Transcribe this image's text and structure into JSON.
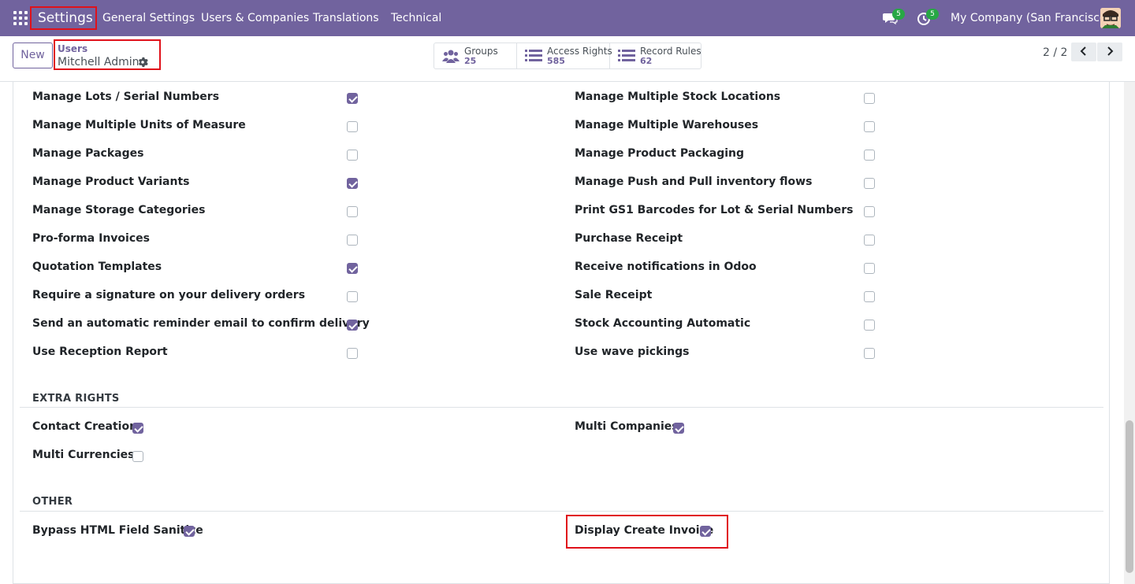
{
  "navbar": {
    "brand": "Settings",
    "menu": [
      "General Settings",
      "Users & Companies",
      "Translations",
      "Technical"
    ],
    "messages_badge": "5",
    "activities_badge": "5",
    "company": "My Company (San Francisco)"
  },
  "control": {
    "new_label": "New",
    "breadcrumb_parent": "Users",
    "breadcrumb_current": "Mitchell Admin",
    "stats": [
      {
        "label": "Groups",
        "value": "25",
        "icon": "users-icon"
      },
      {
        "label": "Access Rights",
        "value": "585",
        "icon": "list-icon"
      },
      {
        "label": "Record Rules",
        "value": "62",
        "icon": "list-icon"
      }
    ],
    "pager": "2 / 2"
  },
  "rights_left": [
    {
      "label": "Manage Lots / Serial Numbers",
      "checked": true
    },
    {
      "label": "Manage Multiple Units of Measure",
      "checked": false
    },
    {
      "label": "Manage Packages",
      "checked": false
    },
    {
      "label": "Manage Product Variants",
      "checked": true
    },
    {
      "label": "Manage Storage Categories",
      "checked": false
    },
    {
      "label": "Pro-forma Invoices",
      "checked": false
    },
    {
      "label": "Quotation Templates",
      "checked": true
    },
    {
      "label": "Require a signature on your delivery orders",
      "checked": false
    },
    {
      "label": "Send an automatic reminder email to confirm delivery",
      "checked": true
    },
    {
      "label": "Use Reception Report",
      "checked": false
    }
  ],
  "rights_right": [
    {
      "label": "Manage Multiple Stock Locations",
      "checked": false
    },
    {
      "label": "Manage Multiple Warehouses",
      "checked": false
    },
    {
      "label": "Manage Product Packaging",
      "checked": false
    },
    {
      "label": "Manage Push and Pull inventory flows",
      "checked": false
    },
    {
      "label": "Print GS1 Barcodes for Lot & Serial Numbers",
      "checked": false
    },
    {
      "label": "Purchase Receipt",
      "checked": false
    },
    {
      "label": "Receive notifications in Odoo",
      "checked": false
    },
    {
      "label": "Sale Receipt",
      "checked": false
    },
    {
      "label": "Stock Accounting Automatic",
      "checked": false
    },
    {
      "label": "Use wave pickings",
      "checked": false
    }
  ],
  "extra_rights": {
    "title": "EXTRA RIGHTS",
    "contact_creation": {
      "label": "Contact Creation",
      "checked": true
    },
    "multi_currencies": {
      "label": "Multi Currencies",
      "checked": false
    },
    "multi_companies": {
      "label": "Multi Companies",
      "checked": true
    }
  },
  "other": {
    "title": "OTHER",
    "bypass_html": {
      "label": "Bypass HTML Field Sanitize",
      "checked": true
    },
    "display_create_invoice": {
      "label": "Display Create Invoice",
      "checked": true
    }
  },
  "colors": {
    "navbar": "#71639e",
    "accent": "#71639e",
    "highlight": "#e0111a",
    "badge": "#28a745"
  }
}
